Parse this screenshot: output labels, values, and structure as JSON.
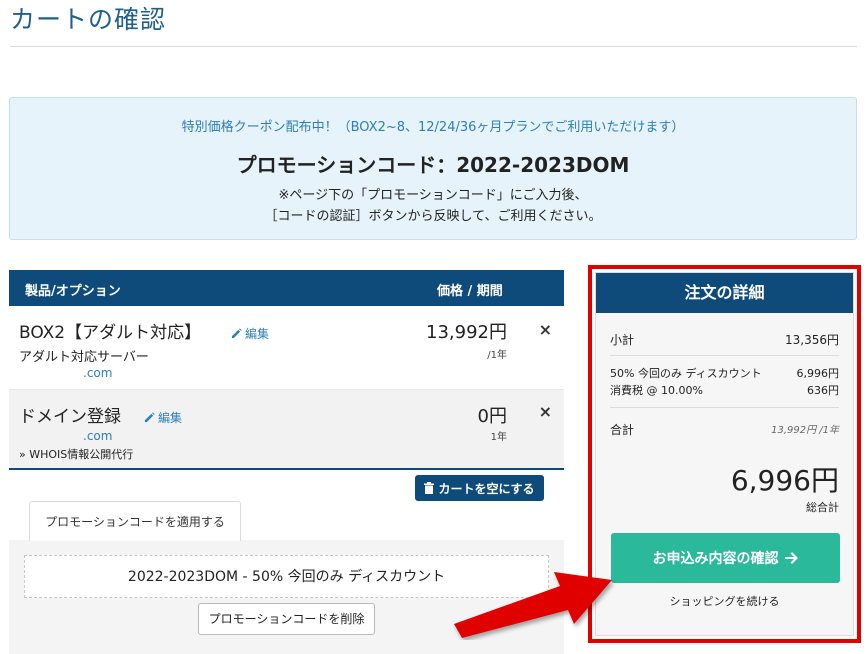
{
  "page": {
    "title": "カートの確認"
  },
  "promo_banner": {
    "line1": "特別価格クーポン配布中！（BOX2~8、12/24/36ヶ月プランでご利用いただけます）",
    "code_line": "プロモーションコード：2022-2023DOM",
    "note1": "※ページ下の「プロモーションコード」にご入力後、",
    "note2": "［コードの認証］ボタンから反映して、ご利用ください。"
  },
  "cart": {
    "headers": {
      "product": "製品/オプション",
      "price": "価格 / 期間"
    },
    "items": [
      {
        "name": "BOX2【アダルト対応】",
        "edit_label": "編集",
        "sub": "アダルト対応サーバー",
        "domain": ".com",
        "price": "13,992円",
        "period": "/1年",
        "remove": "×"
      },
      {
        "name": "ドメイン登録",
        "edit_label": "編集",
        "domain": ".com",
        "extra": "» WHOIS情報公開代行",
        "price": "0円",
        "period": "1年",
        "remove": "×"
      }
    ],
    "empty_cart_label": "カートを空にする"
  },
  "promo_section": {
    "tab_label": "プロモーションコードを適用する",
    "applied_text": "2022-2023DOM - 50% 今回のみ ディスカウント",
    "remove_button": "プロモーションコードを削除"
  },
  "order_details": {
    "title": "注文の詳細",
    "subtotal_label": "小計",
    "subtotal_value": "13,356円",
    "discount_label": "50% 今回のみ ディスカウント",
    "discount_value": "6,996円",
    "tax_label": "消費税 @ 10.00%",
    "tax_value": "636円",
    "total_label": "合計",
    "total_period": "13,992円 /1年",
    "grand_total": "6,996円",
    "grand_total_label": "総合計",
    "checkout_button": "お申込み内容の確認",
    "continue_link": "ショッピングを続ける"
  },
  "colors": {
    "navy": "#0e4a7a",
    "teal": "#2bb99c",
    "link_blue": "#2c7fb8",
    "highlight_red": "#e00000"
  },
  "icons": {
    "edit": "pencil-icon",
    "trash": "trash-icon",
    "arrow_right": "arrow-right-icon",
    "remove": "close-icon"
  }
}
